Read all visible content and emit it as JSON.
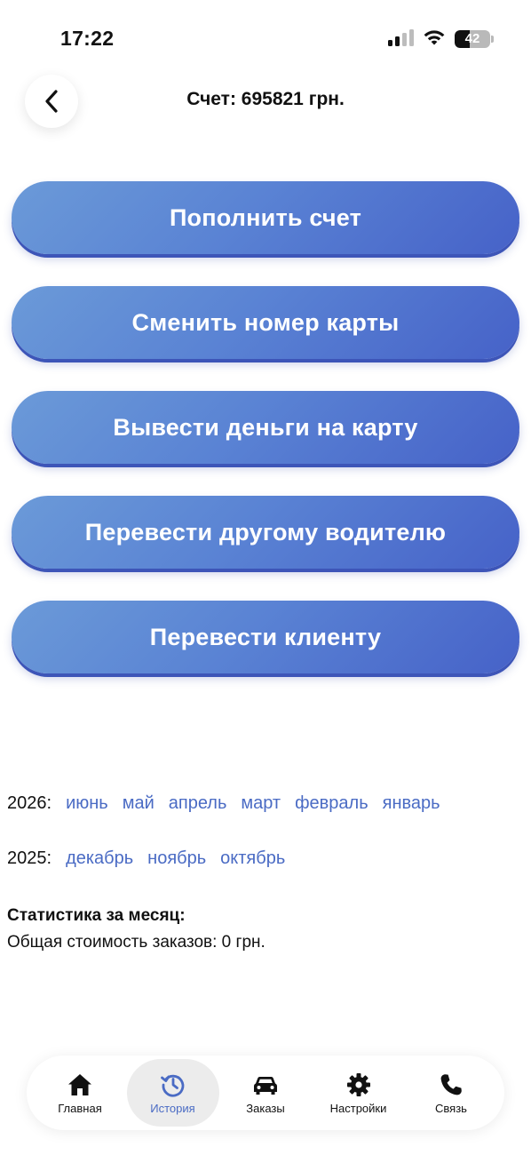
{
  "status_bar": {
    "time": "17:22",
    "battery": "42",
    "battery_level": 0.42
  },
  "header": {
    "back_icon": "chevron-left-icon",
    "title": "Счет: 695821 грн."
  },
  "actions": [
    {
      "label": "Пополнить счет"
    },
    {
      "label": "Сменить номер карты"
    },
    {
      "label": "Вывести деньги на карту"
    },
    {
      "label": "Перевести другому водителю"
    },
    {
      "label": "Перевести клиенту"
    }
  ],
  "history": {
    "years": [
      {
        "year": "2026:",
        "months": [
          "июнь",
          "май",
          "апрель",
          "март",
          "февраль",
          "январь"
        ]
      },
      {
        "year": "2025:",
        "months": [
          "декабрь",
          "ноябрь",
          "октябрь"
        ]
      }
    ]
  },
  "stats": {
    "title": "Статистика за месяц:",
    "total_orders_cost": "Общая стоимость заказов: 0 грн."
  },
  "bottom_nav": {
    "items": [
      {
        "label": "Главная",
        "icon": "home-icon"
      },
      {
        "label": "История",
        "icon": "history-icon",
        "active": true
      },
      {
        "label": "Заказы",
        "icon": "car-icon"
      },
      {
        "label": "Настройки",
        "icon": "gear-icon"
      },
      {
        "label": "Связь",
        "icon": "phone-icon"
      }
    ]
  },
  "colors": {
    "accent": "#4a6bc4",
    "button_gradient_start": "#6b9ad8",
    "button_gradient_end": "#4662c8"
  }
}
